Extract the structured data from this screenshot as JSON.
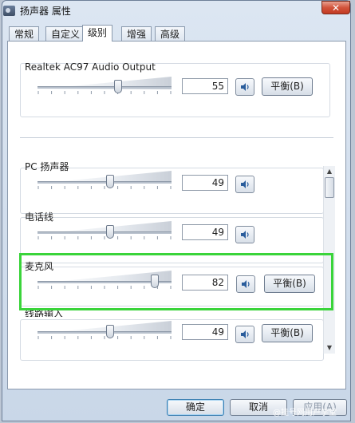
{
  "window": {
    "title": "扬声器 属性",
    "close_glyph": "✕"
  },
  "tabs": [
    {
      "label": "常规",
      "active": false
    },
    {
      "label": "自定义",
      "active": false
    },
    {
      "label": "级别",
      "active": true
    },
    {
      "label": "增强",
      "active": false
    },
    {
      "label": "高级",
      "active": false
    }
  ],
  "master": {
    "label": "Realtek AC97 Audio Output",
    "value": "55",
    "level": 55,
    "balance_label": "平衡(B)"
  },
  "channels": [
    {
      "label": "PC 扬声器",
      "value": "49",
      "level": 49,
      "show_balance": false
    },
    {
      "label": "电话线",
      "value": "49",
      "level": 49,
      "show_balance": false
    },
    {
      "label": "麦克风",
      "value": "82",
      "level": 82,
      "show_balance": true,
      "balance_label": "平衡(B)"
    },
    {
      "label": "线路输入",
      "value": "49",
      "level": 49,
      "show_balance": true,
      "balance_label": "平衡(B)"
    }
  ],
  "buttons": {
    "ok": "确定",
    "cancel": "取消",
    "apply": "应用(A)"
  },
  "watermark": "@挂号网用户学堂",
  "icons": {
    "speaker": "speaker-icon",
    "app": "speaker-app-icon",
    "scroll_up": "scroll-up-arrow-icon",
    "scroll_down": "scroll-down-arrow-icon"
  },
  "colors": {
    "highlight": "#3ad43a",
    "close": "#c8432b"
  }
}
